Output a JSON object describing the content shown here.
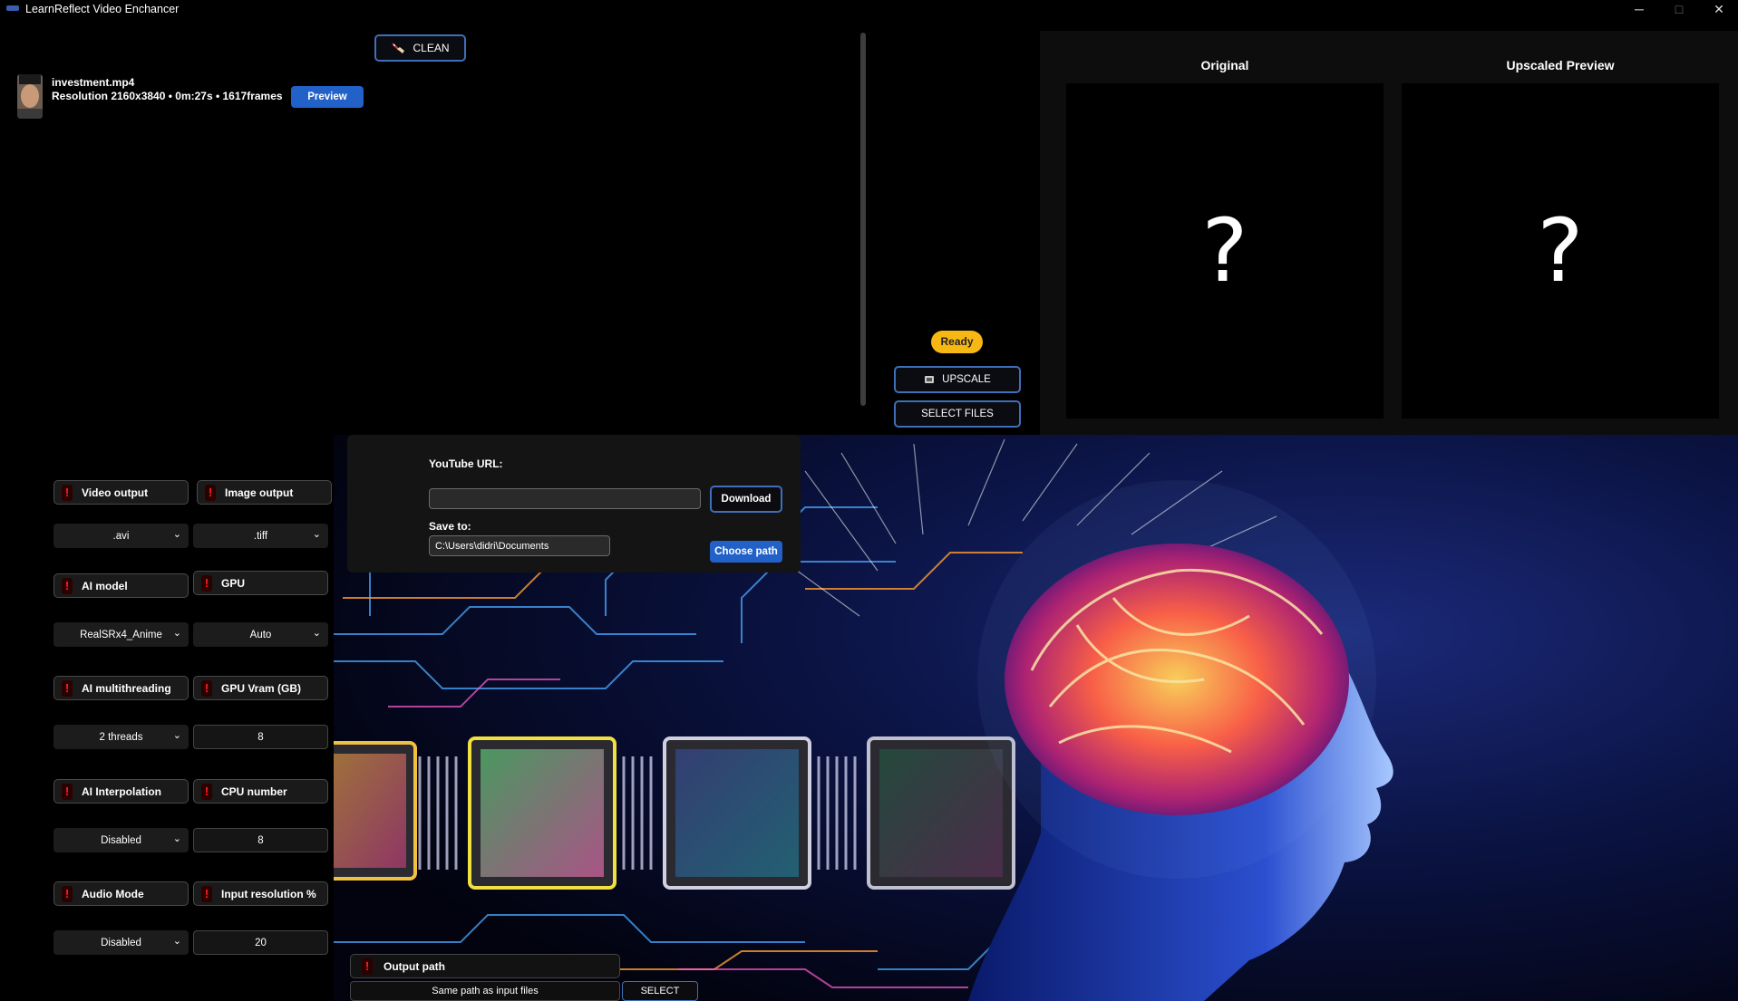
{
  "window": {
    "title": "LearnReflect Video Enchancer",
    "controls": {
      "minimize": "─",
      "maximize": "□",
      "close": "✕"
    }
  },
  "file_list": {
    "clean_label": "CLEAN",
    "file": {
      "name": "investment.mp4",
      "info": "Resolution 2160x3840 • 0m:27s • 1617frames",
      "preview_label": "Preview"
    }
  },
  "status": {
    "text": "Ready",
    "color": "#f7b814"
  },
  "actions": {
    "upscale_label": "UPSCALE",
    "select_files_label": "SELECT FILES"
  },
  "preview_panel": {
    "original_title": "Original",
    "upscaled_title": "Upscaled Preview",
    "placeholder": "?"
  },
  "youtube": {
    "url_label": "YouTube URL:",
    "url_value": "",
    "download_label": "Download",
    "save_to_label": "Save to:",
    "save_to_value": "C:\\Users\\didri\\Documents",
    "choose_path_label": "Choose path"
  },
  "settings": {
    "warn_glyph": "!",
    "video_output": {
      "label": "Video output",
      "value": ".avi"
    },
    "image_output": {
      "label": "Image output",
      "value": ".tiff"
    },
    "ai_model": {
      "label": "AI model",
      "value": "RealSRx4_Anime"
    },
    "gpu": {
      "label": "GPU",
      "value": "Auto"
    },
    "ai_multithreading": {
      "label": "AI multithreading",
      "value": "2 threads"
    },
    "gpu_vram": {
      "label": "GPU Vram (GB)",
      "value": "8"
    },
    "ai_interpolation": {
      "label": "AI Interpolation",
      "value": "Disabled"
    },
    "cpu_number": {
      "label": "CPU number",
      "value": "8"
    },
    "audio_mode": {
      "label": "Audio Mode",
      "value": "Disabled"
    },
    "input_resolution": {
      "label": "Input resolution %",
      "value": "20"
    },
    "output_path": {
      "label": "Output path",
      "value": "Same path as input files",
      "select_label": "SELECT"
    }
  },
  "colors": {
    "accent": "#2261c8",
    "button_border": "#3e6fb8",
    "warning": "#ff2020"
  }
}
